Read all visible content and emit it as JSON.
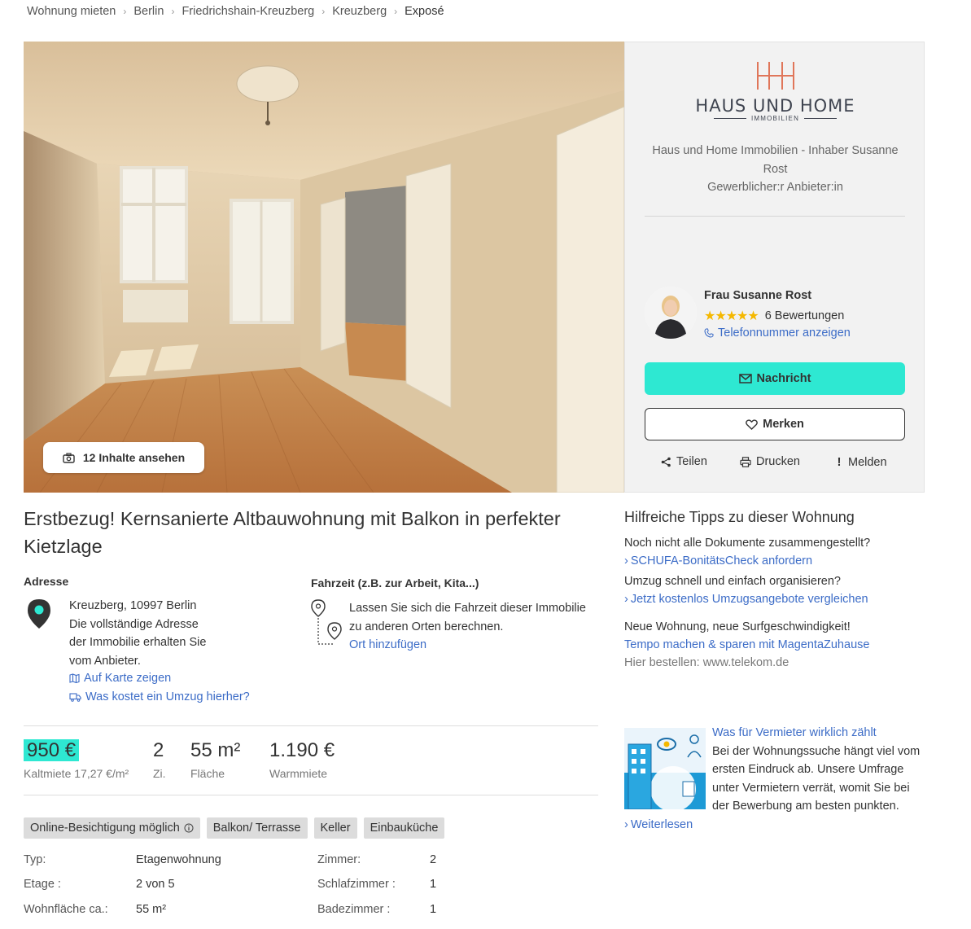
{
  "breadcrumb": [
    "Wohnung mieten",
    "Berlin",
    "Friedrichshain-Kreuzberg",
    "Kreuzberg",
    "Exposé"
  ],
  "gallery": {
    "button_label": "12 Inhalte ansehen",
    "icon": "camera-icon"
  },
  "agent": {
    "logo_name": "HAUS UND HOME",
    "logo_sub": "IMMOBILIEN",
    "company": "Haus und Home Immobilien - Inhaber Susanne Rost",
    "type": "Gewerblicher:r Anbieter:in",
    "name": "Frau Susanne Rost",
    "rating_count": "6 Bewertungen",
    "rating_stars": 5,
    "phone_link": "Telefonnummer anzeigen",
    "message_button": "Nachricht",
    "save_button": "Merken",
    "share": "Teilen",
    "print": "Drucken",
    "report": "Melden",
    "accent_color": "#2ee8d2",
    "star_color": "#f5b800"
  },
  "listing": {
    "title": "Erstbezug! Kernsanierte Altbauwohnung mit Balkon in perfekter Kietzlage",
    "address_label": "Adresse",
    "address_line": "Kreuzberg, 10997 Berlin",
    "address_note": [
      "Die vollständige Adresse",
      "der Immobilie erhalten Sie",
      "vom Anbieter."
    ],
    "map_link": "Auf Karte zeigen",
    "move_link": "Was kostet ein Umzug hierher?",
    "travel_label": "Fahrzeit (z.B. zur Arbeit, Kita...)",
    "travel_text": "Lassen Sie sich die Fahrzeit dieser Immobilie zu anderen Orten berechnen.",
    "travel_link": "Ort hinzufügen"
  },
  "key_facts": {
    "price": "950 €",
    "price_label": "Kaltmiete 17,27 €/m²",
    "rooms": "2",
    "rooms_label": "Zi.",
    "area": "55 m²",
    "area_label": "Fläche",
    "warm": "1.190 €",
    "warm_label": "Warmmiete"
  },
  "tags": [
    "Online-Besichtigung möglich",
    "Balkon/ Terrasse",
    "Keller",
    "Einbauküche"
  ],
  "facts_left": [
    {
      "k": "Typ:",
      "v": "Etagenwohnung"
    },
    {
      "k": "Etage :",
      "v": "2 von 5"
    },
    {
      "k": "Wohnfläche ca.:",
      "v": "55 m²"
    }
  ],
  "facts_right": [
    {
      "k": "Zimmer:",
      "v": "2"
    },
    {
      "k": "Schlafzimmer :",
      "v": "1"
    },
    {
      "k": "Badezimmer :",
      "v": "1"
    }
  ],
  "tips": {
    "title": "Hilfreiche Tipps zu dieser Wohnung",
    "t1_text": "Noch nicht alle Dokumente zusammengestellt?",
    "t1_link": "SCHUFA-BonitätsCheck anfordern",
    "t2_text": "Umzug schnell und einfach organisieren?",
    "t2_link": "Jetzt kostenlos Umzugsangebote vergleichen",
    "t3_text": "Neue Wohnung, neue Surfgeschwindigkeit!",
    "t3_link": "Tempo machen & sparen mit MagentaZuhause",
    "t3_note": "Hier bestellen: www.telekom.de"
  },
  "article": {
    "title": "Was für Vermieter wirklich zählt",
    "body": "Bei der Wohnungssuche hängt viel vom ersten Eindruck ab. Unsere Umfrage unter Vermietern verrät, womit Sie bei der Bewerbung am besten punkten.",
    "more": "Weiterlesen"
  }
}
